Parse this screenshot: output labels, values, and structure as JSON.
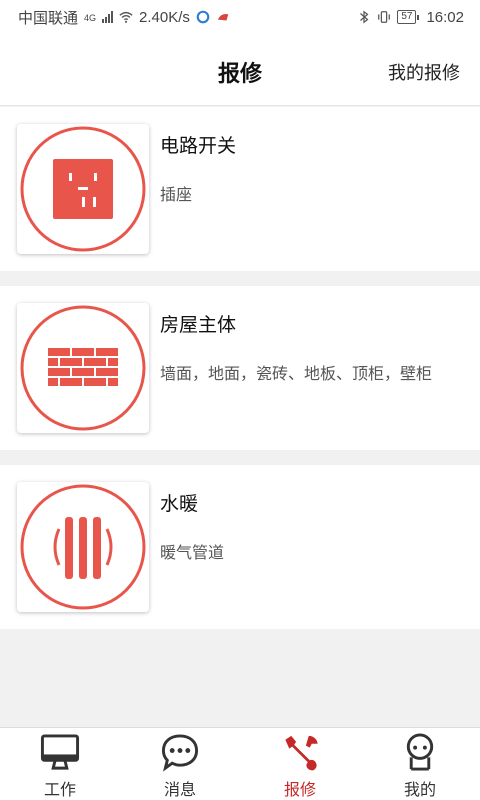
{
  "status_bar": {
    "carrier": "中国联通",
    "network_type": "4G",
    "speed": "2.40K/s",
    "battery": "57",
    "time": "16:02"
  },
  "header": {
    "title": "报修",
    "right_link": "我的报修"
  },
  "categories": [
    {
      "name": "电路开关",
      "desc": "插座",
      "icon": "socket-icon"
    },
    {
      "name": "房屋主体",
      "desc": "墙面，地面，瓷砖、地板、顶柜，壁柜",
      "icon": "brick-wall-icon"
    },
    {
      "name": "水暖",
      "desc": "暖气管道",
      "icon": "radiator-icon"
    }
  ],
  "tabs": [
    {
      "label": "工作",
      "icon": "monitor-icon",
      "active": false
    },
    {
      "label": "消息",
      "icon": "chat-bubble-icon",
      "active": false
    },
    {
      "label": "报修",
      "icon": "wrench-icon",
      "active": true
    },
    {
      "label": "我的",
      "icon": "user-icon",
      "active": false
    }
  ],
  "colors": {
    "accent": "#e8554a",
    "active_tab": "#c62828"
  }
}
